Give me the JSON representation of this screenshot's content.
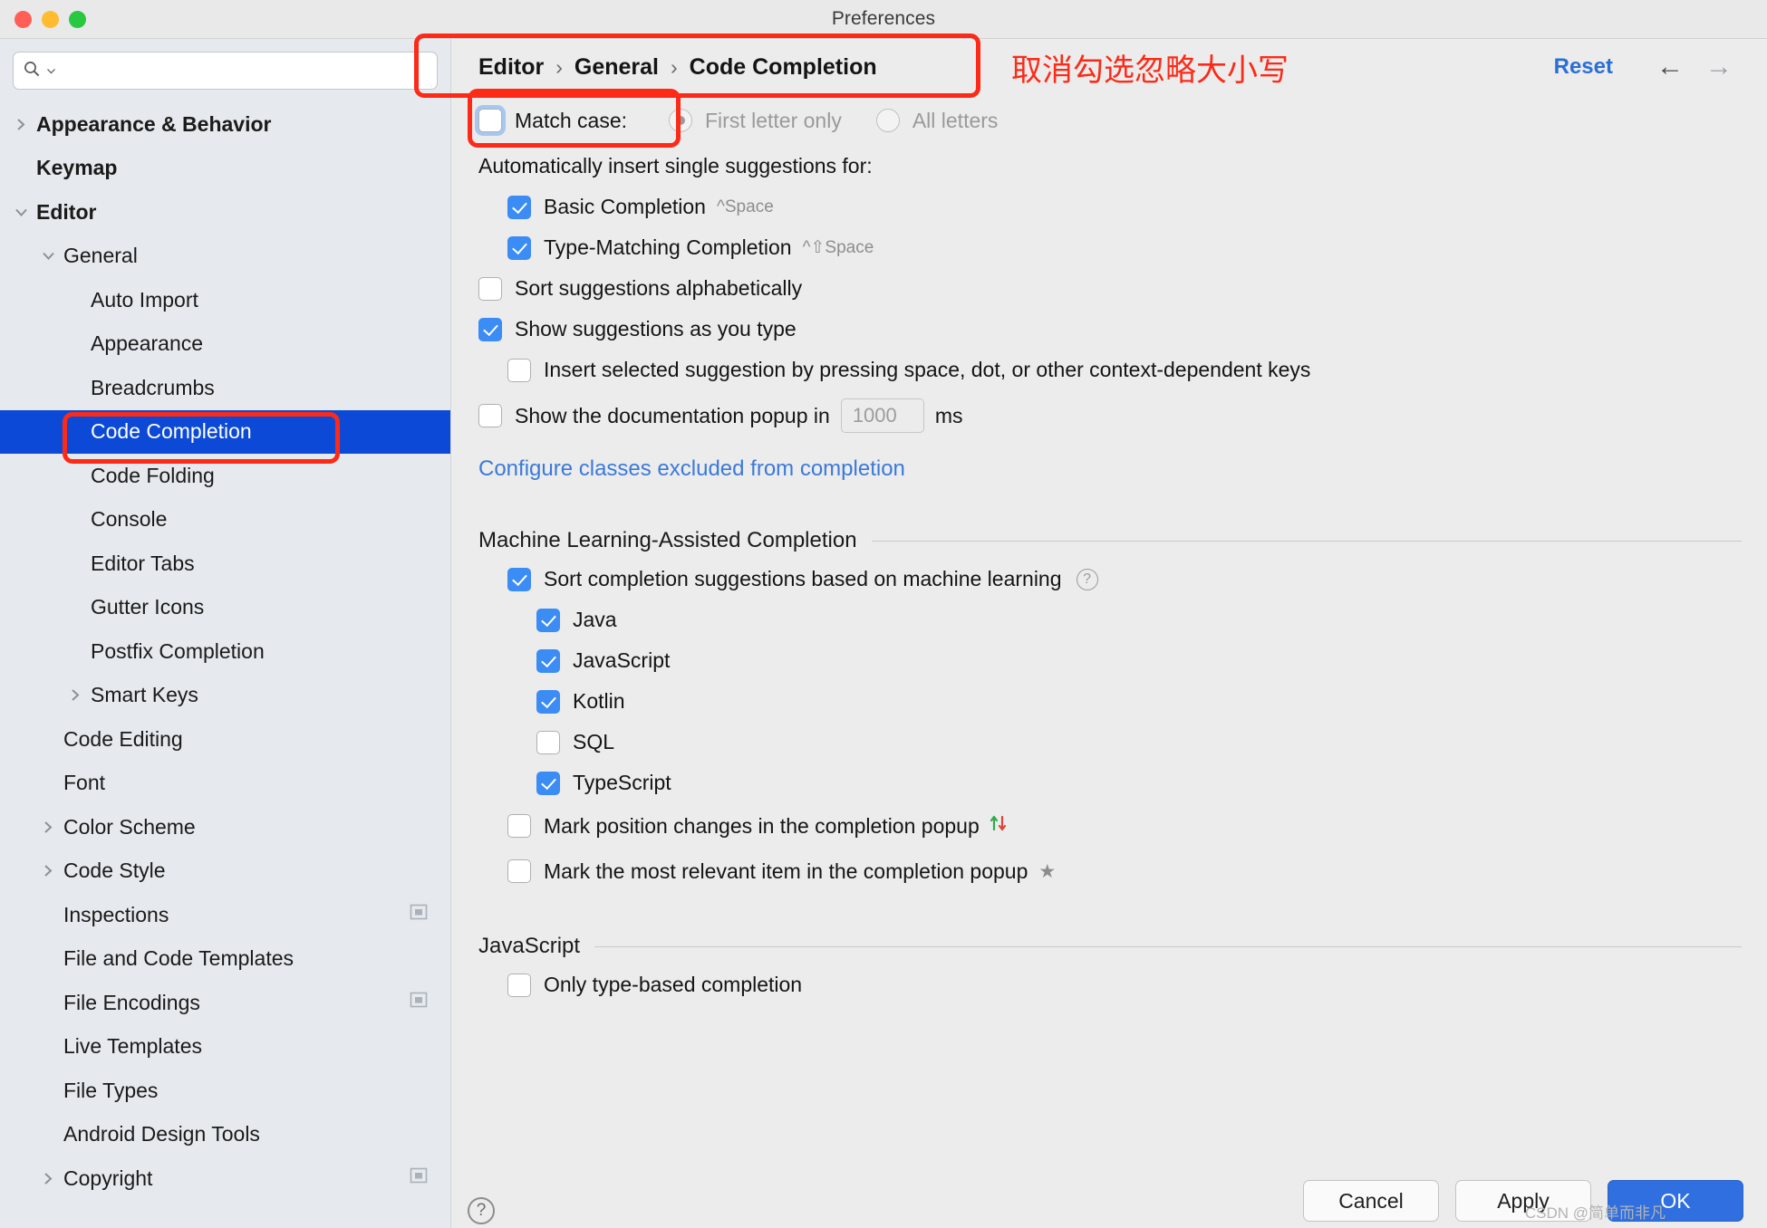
{
  "window": {
    "title": "Preferences",
    "traffic_lights": [
      "close-button",
      "minimize-button",
      "zoom-button"
    ]
  },
  "sidebar": {
    "search": {
      "value": "",
      "placeholder": ""
    },
    "items": [
      {
        "label": "Appearance & Behavior",
        "level": 0,
        "twisty": "collapsed",
        "bold": true,
        "selected": false,
        "badge": ""
      },
      {
        "label": "Keymap",
        "level": 0,
        "twisty": "none",
        "bold": true,
        "selected": false,
        "badge": ""
      },
      {
        "label": "Editor",
        "level": 0,
        "twisty": "expanded",
        "bold": true,
        "selected": false,
        "badge": ""
      },
      {
        "label": "General",
        "level": 1,
        "twisty": "expanded",
        "bold": false,
        "selected": false,
        "badge": ""
      },
      {
        "label": "Auto Import",
        "level": 2,
        "twisty": "none",
        "bold": false,
        "selected": false,
        "badge": ""
      },
      {
        "label": "Appearance",
        "level": 2,
        "twisty": "none",
        "bold": false,
        "selected": false,
        "badge": ""
      },
      {
        "label": "Breadcrumbs",
        "level": 2,
        "twisty": "none",
        "bold": false,
        "selected": false,
        "badge": ""
      },
      {
        "label": "Code Completion",
        "level": 2,
        "twisty": "none",
        "bold": false,
        "selected": true,
        "badge": ""
      },
      {
        "label": "Code Folding",
        "level": 2,
        "twisty": "none",
        "bold": false,
        "selected": false,
        "badge": ""
      },
      {
        "label": "Console",
        "level": 2,
        "twisty": "none",
        "bold": false,
        "selected": false,
        "badge": ""
      },
      {
        "label": "Editor Tabs",
        "level": 2,
        "twisty": "none",
        "bold": false,
        "selected": false,
        "badge": ""
      },
      {
        "label": "Gutter Icons",
        "level": 2,
        "twisty": "none",
        "bold": false,
        "selected": false,
        "badge": ""
      },
      {
        "label": "Postfix Completion",
        "level": 2,
        "twisty": "none",
        "bold": false,
        "selected": false,
        "badge": ""
      },
      {
        "label": "Smart Keys",
        "level": 2,
        "twisty": "collapsed",
        "bold": false,
        "selected": false,
        "badge": ""
      },
      {
        "label": "Code Editing",
        "level": 1,
        "twisty": "none",
        "bold": false,
        "selected": false,
        "badge": ""
      },
      {
        "label": "Font",
        "level": 1,
        "twisty": "none",
        "bold": false,
        "selected": false,
        "badge": ""
      },
      {
        "label": "Color Scheme",
        "level": 1,
        "twisty": "collapsed",
        "bold": false,
        "selected": false,
        "badge": ""
      },
      {
        "label": "Code Style",
        "level": 1,
        "twisty": "collapsed",
        "bold": false,
        "selected": false,
        "badge": ""
      },
      {
        "label": "Inspections",
        "level": 1,
        "twisty": "none",
        "bold": false,
        "selected": false,
        "badge": "project-scope-icon"
      },
      {
        "label": "File and Code Templates",
        "level": 1,
        "twisty": "none",
        "bold": false,
        "selected": false,
        "badge": ""
      },
      {
        "label": "File Encodings",
        "level": 1,
        "twisty": "none",
        "bold": false,
        "selected": false,
        "badge": "project-scope-icon"
      },
      {
        "label": "Live Templates",
        "level": 1,
        "twisty": "none",
        "bold": false,
        "selected": false,
        "badge": ""
      },
      {
        "label": "File Types",
        "level": 1,
        "twisty": "none",
        "bold": false,
        "selected": false,
        "badge": ""
      },
      {
        "label": "Android Design Tools",
        "level": 1,
        "twisty": "none",
        "bold": false,
        "selected": false,
        "badge": ""
      },
      {
        "label": "Copyright",
        "level": 1,
        "twisty": "collapsed",
        "bold": false,
        "selected": false,
        "badge": "project-scope-icon"
      }
    ]
  },
  "breadcrumb": {
    "parts": [
      "Editor",
      "General",
      "Code Completion"
    ],
    "separator": "›",
    "reset_label": "Reset",
    "back_arrow": "←",
    "forward_arrow": "→"
  },
  "main": {
    "match_case": {
      "label": "Match case:",
      "checked": false,
      "focused": true,
      "options": [
        {
          "label": "First letter only",
          "selected": true
        },
        {
          "label": "All letters",
          "selected": false
        }
      ]
    },
    "auto_insert_label": "Automatically insert single suggestions for:",
    "auto_insert_items": [
      {
        "label": "Basic Completion",
        "shortcut": "^Space",
        "checked": true
      },
      {
        "label": "Type-Matching Completion",
        "shortcut": "^⇧Space",
        "checked": true
      }
    ],
    "sort_alphabetically": {
      "label": "Sort suggestions alphabetically",
      "checked": false
    },
    "show_as_you_type": {
      "label": "Show suggestions as you type",
      "checked": true
    },
    "insert_by_pressing": {
      "label": "Insert selected suggestion by pressing space, dot, or other context-dependent keys",
      "checked": false
    },
    "doc_popup": {
      "label_before": "Show the documentation popup in",
      "value": "1000",
      "label_after": "ms",
      "checked": false
    },
    "configure_link": "Configure classes excluded from completion",
    "ml_section": {
      "title": "Machine Learning-Assisted Completion",
      "sort_ml": {
        "label": "Sort completion suggestions based on machine learning",
        "checked": true,
        "help": "?"
      },
      "languages": [
        {
          "label": "Java",
          "checked": true
        },
        {
          "label": "JavaScript",
          "checked": true
        },
        {
          "label": "Kotlin",
          "checked": true
        },
        {
          "label": "SQL",
          "checked": false
        },
        {
          "label": "TypeScript",
          "checked": true
        }
      ],
      "mark_position": {
        "label": "Mark position changes in the completion popup",
        "checked": false,
        "icon": "up-down-arrows-icon"
      },
      "mark_relevant": {
        "label": "Mark the most relevant item in the completion popup",
        "checked": false,
        "icon": "star-icon"
      }
    },
    "js_section": {
      "title": "JavaScript",
      "only_type_based": {
        "label": "Only type-based completion",
        "checked": false
      }
    }
  },
  "footer": {
    "cancel_label": "Cancel",
    "apply_label": "Apply",
    "ok_label": "OK",
    "help_icon": "?",
    "watermark": "CSDN @简单而非凡"
  },
  "annotations": {
    "note_text": "取消勾选忽略大小写",
    "accent_color": "#fc2a17"
  },
  "colors": {
    "selection_blue": "#0b49d6",
    "checkbox_blue": "#3b8cf5",
    "link_blue": "#3a7ad9",
    "sidebar_bg": "#e6eaee",
    "panel_bg": "#ececec",
    "annotation_red": "#fc2a17"
  }
}
